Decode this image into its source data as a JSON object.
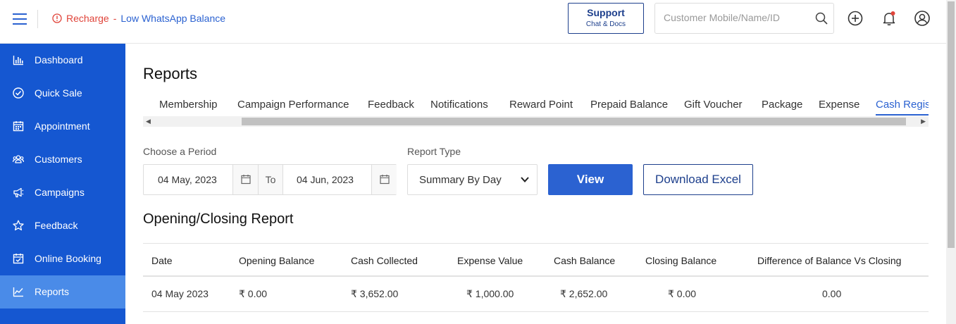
{
  "header": {
    "alert_warn": "Recharge",
    "alert_sep": "-",
    "alert_link": "Low WhatsApp Balance",
    "support_title": "Support",
    "support_sub": "Chat & Docs",
    "search_placeholder": "Customer Mobile/Name/ID"
  },
  "sidebar": {
    "items": [
      {
        "label": "Dashboard",
        "icon": "bar-chart-icon"
      },
      {
        "label": "Quick Sale",
        "icon": "check-circle-icon"
      },
      {
        "label": "Appointment",
        "icon": "calendar-icon"
      },
      {
        "label": "Customers",
        "icon": "users-icon"
      },
      {
        "label": "Campaigns",
        "icon": "megaphone-icon"
      },
      {
        "label": "Feedback",
        "icon": "star-icon"
      },
      {
        "label": "Online Booking",
        "icon": "calendar-check-icon"
      },
      {
        "label": "Reports",
        "icon": "line-chart-icon",
        "active": true
      }
    ]
  },
  "main": {
    "title": "Reports",
    "tabs": [
      "Membership",
      "Campaign Performance",
      "Feedback",
      "Notifications",
      "Reward Point",
      "Prepaid Balance",
      "Gift Voucher",
      "Package",
      "Expense",
      "Cash Register"
    ],
    "active_tab": "Cash Register",
    "period_label": "Choose a Period",
    "from_date": "04 May, 2023",
    "to_label": "To",
    "to_date": "04 Jun, 2023",
    "report_type_label": "Report Type",
    "report_type_value": "Summary By Day",
    "view_label": "View",
    "download_label": "Download Excel",
    "section_title": "Opening/Closing Report",
    "table": {
      "columns": [
        "Date",
        "Opening Balance",
        "Cash Collected",
        "Expense Value",
        "Cash Balance",
        "Closing Balance",
        "Difference of Balance Vs Closing"
      ],
      "rows": [
        [
          "04 May 2023",
          "₹ 0.00",
          "₹ 3,652.00",
          "₹ 1,000.00",
          "₹ 2,652.00",
          "₹ 0.00",
          "0.00"
        ]
      ]
    }
  },
  "colors": {
    "primary": "#2b62d1",
    "sidebar": "#1557d1",
    "sidebar_active": "#4a8be8",
    "warn": "#e0443a",
    "dark_blue": "#1d3f8c"
  }
}
